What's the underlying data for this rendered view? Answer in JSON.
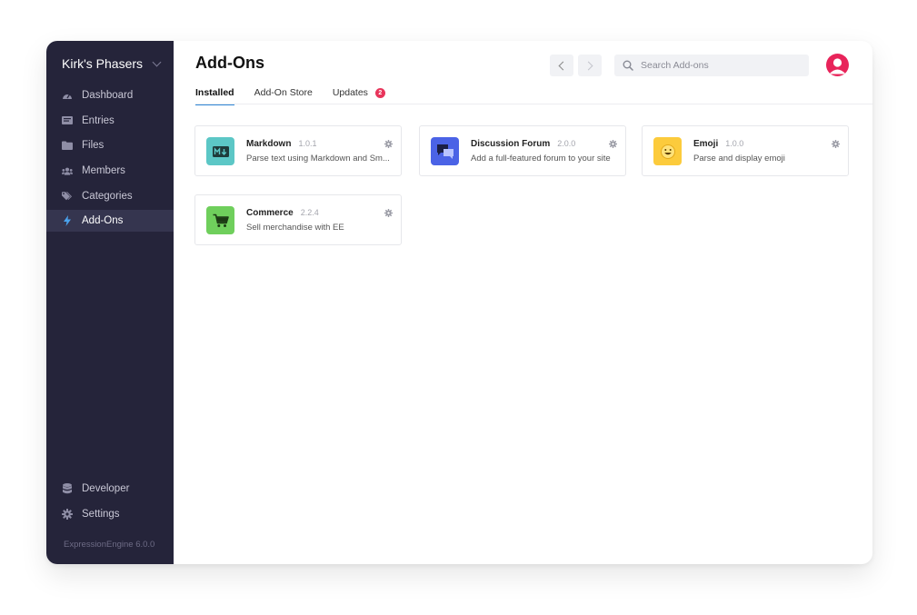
{
  "site": {
    "name": "Kirk's Phasers"
  },
  "sidebar": {
    "items": [
      {
        "label": "Dashboard",
        "icon": "dashboard-icon"
      },
      {
        "label": "Entries",
        "icon": "entries-icon"
      },
      {
        "label": "Files",
        "icon": "folder-icon"
      },
      {
        "label": "Members",
        "icon": "members-icon"
      },
      {
        "label": "Categories",
        "icon": "tags-icon"
      },
      {
        "label": "Add-Ons",
        "icon": "bolt-icon",
        "active": true
      }
    ],
    "bottom": [
      {
        "label": "Developer",
        "icon": "database-icon"
      },
      {
        "label": "Settings",
        "icon": "gear-icon"
      }
    ],
    "version": "ExpressionEngine 6.0.0"
  },
  "header": {
    "title": "Add-Ons",
    "search_placeholder": "Search Add-ons"
  },
  "tabs": [
    {
      "label": "Installed",
      "active": true
    },
    {
      "label": "Add-On Store"
    },
    {
      "label": "Updates",
      "badge": "2"
    }
  ],
  "addons": [
    {
      "name": "Markdown",
      "version": "1.0.1",
      "description": "Parse text using Markdown and Sm...",
      "color": "#5cc7c6",
      "icon": "markdown-icon"
    },
    {
      "name": "Discussion Forum",
      "version": "2.0.0",
      "description": "Add a full-featured forum to your site",
      "color": "#4b63e6",
      "icon": "chat-bubbles-icon"
    },
    {
      "name": "Emoji",
      "version": "1.0.0",
      "description": "Parse and display emoji",
      "color": "#fccb3c",
      "icon": "smiley-icon"
    },
    {
      "name": "Commerce",
      "version": "2.2.4",
      "description": "Sell merchandise with EE",
      "color": "#6fcf5c",
      "icon": "cart-icon"
    }
  ],
  "colors": {
    "sidebar_bg": "#25243a",
    "active_nav": "#35354f",
    "accent": "#2f86d6",
    "badge": "#e8355b",
    "avatar": "#e8245a"
  }
}
